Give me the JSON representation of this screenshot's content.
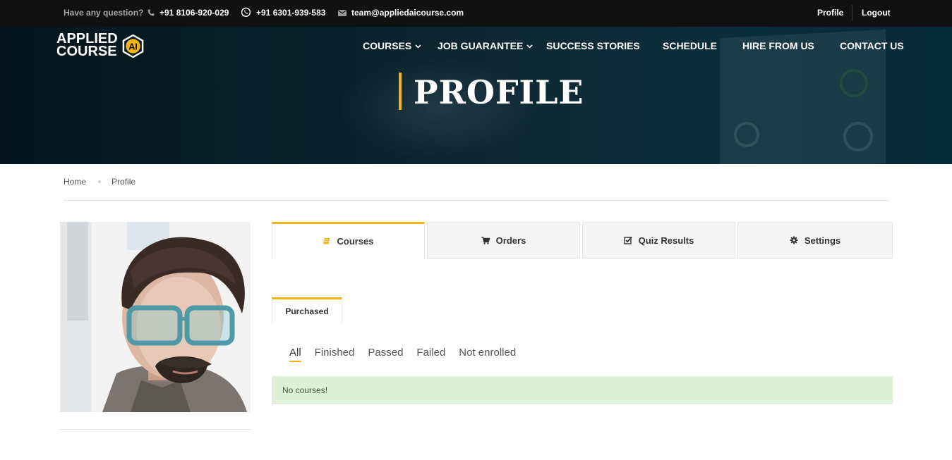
{
  "topbar": {
    "question": "Have any question?",
    "phone": "+91 8106-920-029",
    "whatsapp": "+91 6301-939-583",
    "email": "team@appliedaicourse.com",
    "profile": "Profile",
    "logout": "Logout"
  },
  "logo": {
    "line1": "APPLIED",
    "line2": "COURSE",
    "badge": "AI"
  },
  "nav": {
    "courses": "COURSES",
    "job_guarantee": "JOB GUARANTEE",
    "success_stories": "SUCCESS STORIES",
    "schedule": "SCHEDULE",
    "hire_from_us": "HIRE FROM US",
    "contact_us": "CONTACT US"
  },
  "hero": {
    "title": "PROFILE"
  },
  "breadcrumb": {
    "home": "Home",
    "current": "Profile"
  },
  "tabs": {
    "courses": "Courses",
    "orders": "Orders",
    "quiz_results": "Quiz Results",
    "settings": "Settings"
  },
  "subtab": {
    "purchased": "Purchased"
  },
  "filters": {
    "all": "All",
    "finished": "Finished",
    "passed": "Passed",
    "failed": "Failed",
    "not_enrolled": "Not enrolled"
  },
  "notice": {
    "text": "No courses!"
  },
  "colors": {
    "accent": "#f2b416",
    "topbar": "#111111",
    "notice_bg": "#dff0d8"
  },
  "icons": {
    "phone": "phone-icon",
    "whatsapp": "whatsapp-icon",
    "email": "envelope-icon",
    "courses": "book-icon",
    "orders": "cart-icon",
    "quiz": "check-square-icon",
    "settings": "gear-icon"
  }
}
